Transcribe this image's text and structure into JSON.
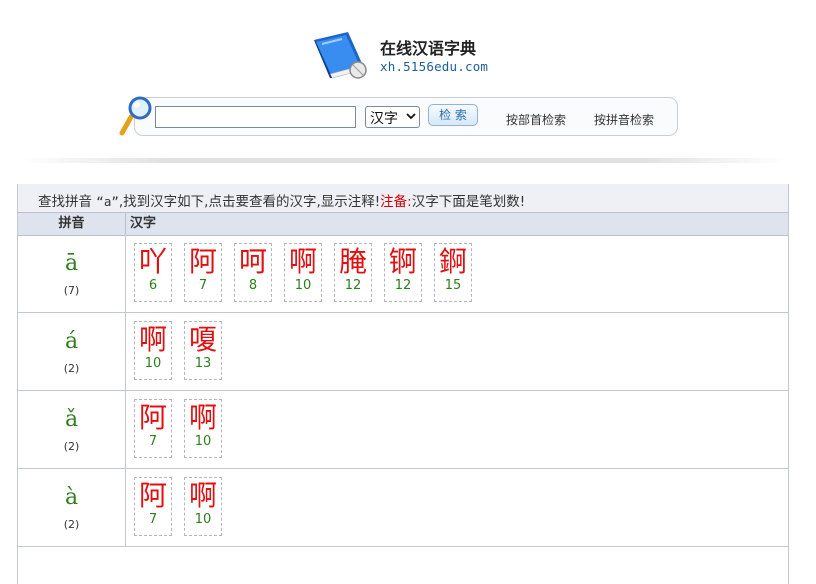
{
  "header": {
    "title": "在线汉语字典",
    "url": "xh.5156edu.com"
  },
  "search": {
    "input_value": "",
    "select_value": "汉字",
    "button_label": "检 索",
    "link_radical": "按部首检索",
    "link_pinyin": "按拼音检索"
  },
  "result": {
    "notice_prefix": "查找拼音",
    "notice_query": "“a”",
    "notice_middle": ",找到汉字如下,点击要查看的汉字,显示注释!",
    "notice_label": "注备:",
    "notice_suffix": "汉字下面是笔划数!",
    "col_pinyin": "拼音",
    "col_hanzi": "汉字",
    "rows": [
      {
        "pinyin": "ā",
        "count": "(7)",
        "chars": [
          {
            "ch": "吖",
            "strokes": "6"
          },
          {
            "ch": "阿",
            "strokes": "7"
          },
          {
            "ch": "呵",
            "strokes": "8"
          },
          {
            "ch": "啊",
            "strokes": "10"
          },
          {
            "ch": "腌",
            "strokes": "12"
          },
          {
            "ch": "锕",
            "strokes": "12"
          },
          {
            "ch": "錒",
            "strokes": "15"
          }
        ]
      },
      {
        "pinyin": "á",
        "count": "(2)",
        "chars": [
          {
            "ch": "啊",
            "strokes": "10"
          },
          {
            "ch": "嗄",
            "strokes": "13"
          }
        ]
      },
      {
        "pinyin": "ǎ",
        "count": "(2)",
        "chars": [
          {
            "ch": "阿",
            "strokes": "7"
          },
          {
            "ch": "啊",
            "strokes": "10"
          }
        ]
      },
      {
        "pinyin": "à",
        "count": "(2)",
        "chars": [
          {
            "ch": "阿",
            "strokes": "7"
          },
          {
            "ch": "啊",
            "strokes": "10"
          }
        ]
      }
    ]
  },
  "colors": {
    "char_red": "#e01010",
    "pinyin_green": "#2e7d1e",
    "notice_red": "#d20000"
  }
}
